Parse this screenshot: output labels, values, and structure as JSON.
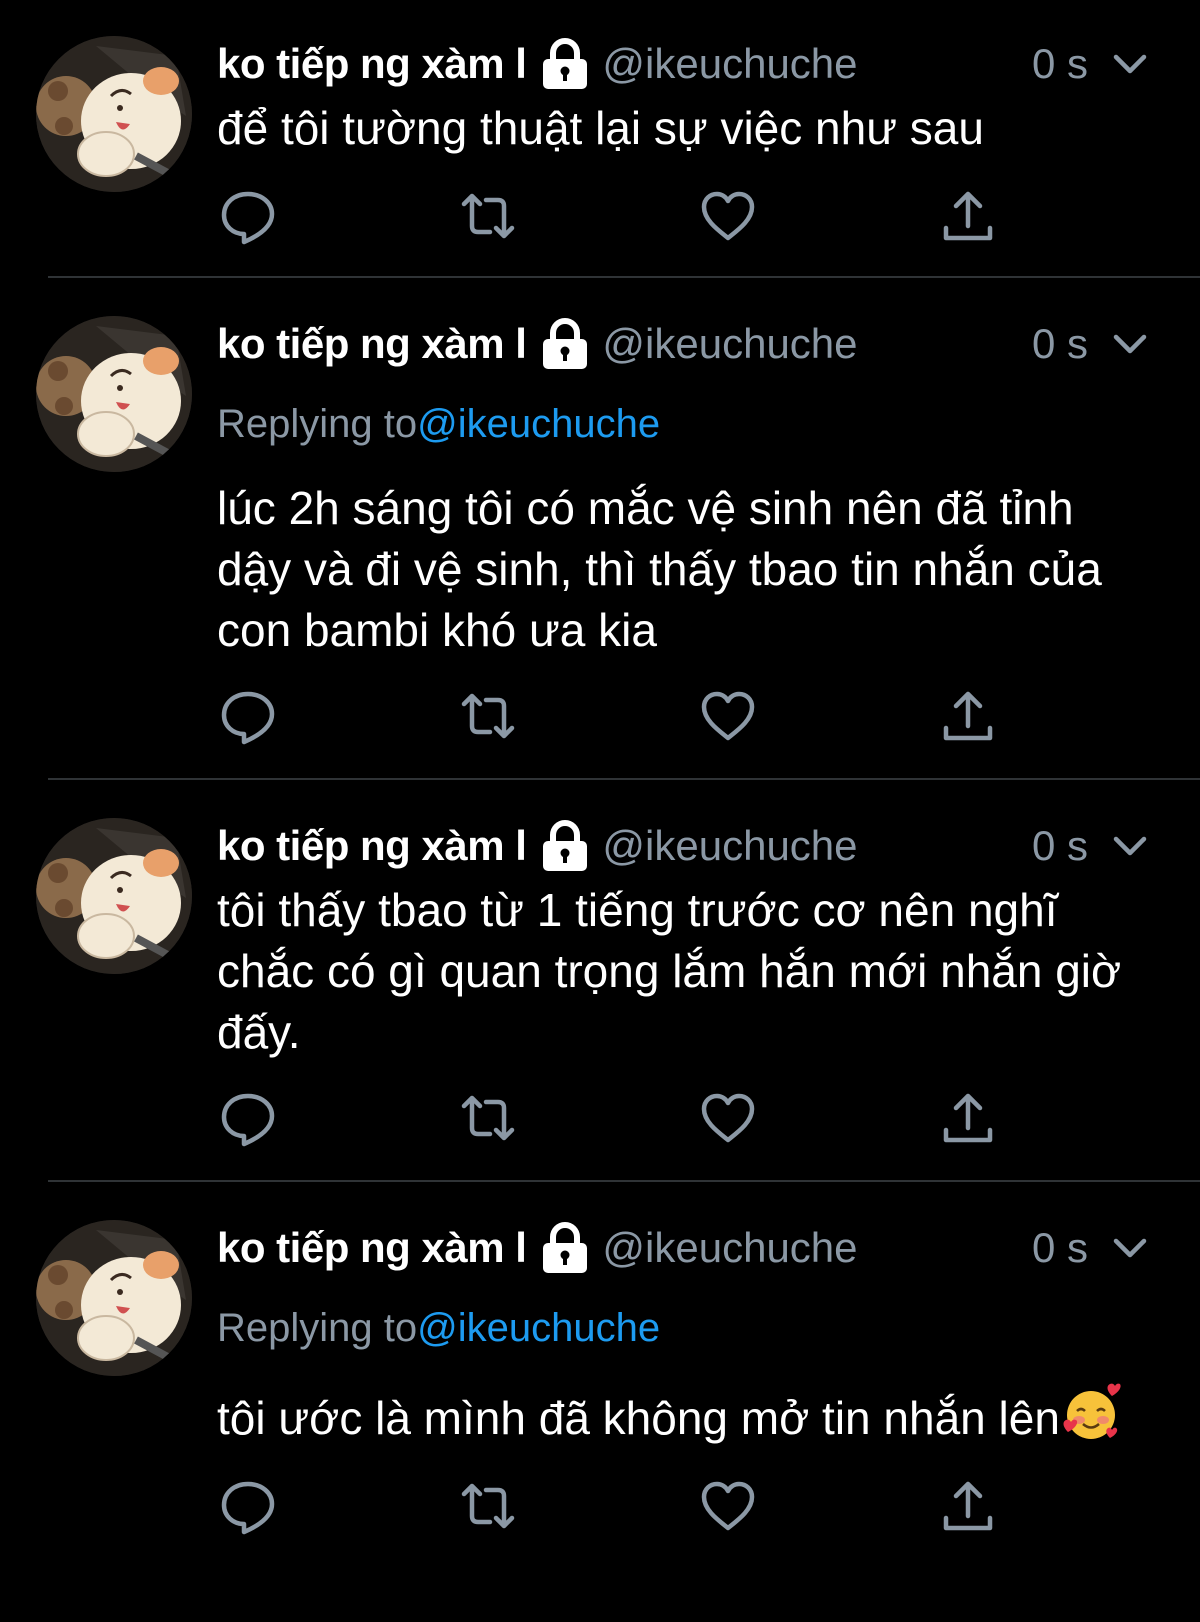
{
  "tweets": [
    {
      "name": "ko tiếp ng xàm l",
      "handle": "@ikeuchuche",
      "time": "0 s",
      "text": "để tôi tường thuật lại sự việc như sau"
    },
    {
      "name": "ko tiếp ng xàm l",
      "handle": "@ikeuchuche",
      "time": "0 s",
      "replying_label": "Replying to",
      "replying_handle": "@ikeuchuche",
      "text": "lúc 2h sáng tôi có mắc vệ sinh nên đã tỉnh dậy và đi vệ sinh, thì thấy tbao tin nhắn của con bambi khó ưa kia"
    },
    {
      "name": "ko tiếp ng xàm l",
      "handle": "@ikeuchuche",
      "time": "0 s",
      "text": "tôi thấy tbao từ 1 tiếng trước cơ nên nghĩ chắc có gì quan trọng lắm hắn mới nhắn giờ đấy."
    },
    {
      "name": "ko tiếp ng xàm l",
      "handle": "@ikeuchuche",
      "time": "0 s",
      "replying_label": "Replying to",
      "replying_handle": "@ikeuchuche",
      "text": "tôi ước là mình đã không mở tin nhắn lên"
    }
  ],
  "icons": {
    "lock": "lock-icon",
    "menu": "chevron-down-icon",
    "reply": "reply-icon",
    "retweet": "retweet-icon",
    "like": "heart-icon",
    "share": "share-icon",
    "emoji": "smiling-face-with-hearts-emoji"
  },
  "colors": {
    "background": "#000000",
    "text": "#ffffff",
    "secondary": "#8b98a5",
    "mention": "#1d9bf0",
    "divider": "#2f3336"
  }
}
